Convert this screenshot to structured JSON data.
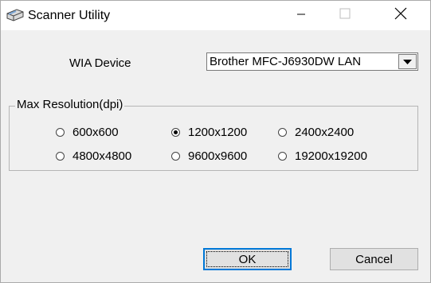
{
  "window": {
    "title": "Scanner Utility",
    "icon": "scanner-icon",
    "controls": [
      "minimize-icon",
      "maximize-icon",
      "close-icon"
    ]
  },
  "device": {
    "label": "WIA Device",
    "selected": "Brother MFC-J6930DW LAN"
  },
  "resolution": {
    "group_label": "Max Resolution(dpi)",
    "options": [
      {
        "label": "600x600",
        "checked": false
      },
      {
        "label": "1200x1200",
        "checked": true
      },
      {
        "label": "2400x2400",
        "checked": false
      },
      {
        "label": "4800x4800",
        "checked": false
      },
      {
        "label": "9600x9600",
        "checked": false
      },
      {
        "label": "19200x19200",
        "checked": false
      }
    ]
  },
  "buttons": {
    "ok": "OK",
    "cancel": "Cancel"
  }
}
